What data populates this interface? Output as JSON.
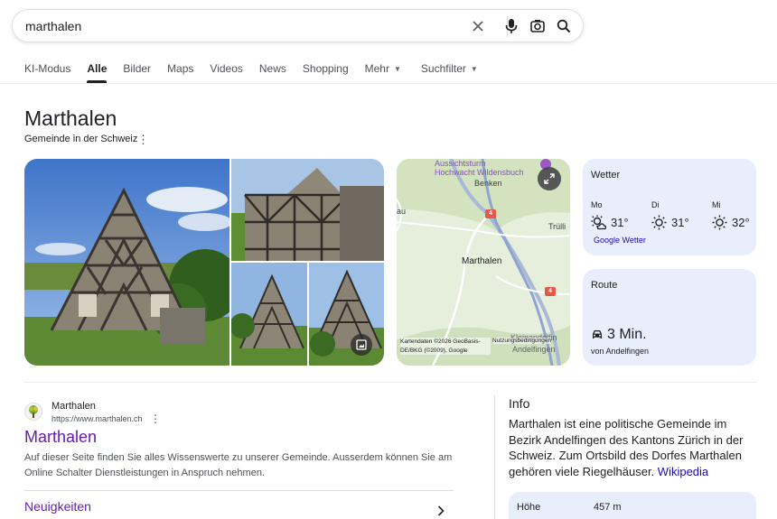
{
  "search": {
    "query": "marthalen"
  },
  "tabs": [
    {
      "label": "KI-Modus"
    },
    {
      "label": "Alle"
    },
    {
      "label": "Bilder"
    },
    {
      "label": "Maps"
    },
    {
      "label": "Videos"
    },
    {
      "label": "News"
    },
    {
      "label": "Shopping"
    },
    {
      "label": "Mehr"
    },
    {
      "label": "Suchfilter"
    }
  ],
  "knowledge": {
    "title": "Marthalen",
    "subtitle": "Gemeinde in der Schweiz"
  },
  "map": {
    "labels": {
      "tower": "Aussichtsturm",
      "hochwacht": "Hochwacht Wildensbuch",
      "benken": "Benken",
      "truellikon": "Trülli",
      "au": "au",
      "marthalen": "Marthalen",
      "kleinandelfingen": "Kleinandelfin",
      "andelfingen": "Andelfingen",
      "road_4a": "4",
      "road_4b": "4"
    },
    "attribution": "Kartendaten ©2026 GeoBasis-DE/BKG (©2009), Google",
    "terms": "Nutzungsbedingungen"
  },
  "weather": {
    "title": "Wetter",
    "days": [
      {
        "day": "Mo",
        "temp": "31°",
        "icon": "sun-cloud-icon"
      },
      {
        "day": "Di",
        "temp": "31°",
        "icon": "sun-icon"
      },
      {
        "day": "Mi",
        "temp": "32°",
        "icon": "sun-icon"
      }
    ],
    "link": "Google Wetter"
  },
  "route": {
    "title": "Route",
    "time": "3 Min.",
    "from": "von Andelfingen",
    "icon": "car-icon"
  },
  "result": {
    "site_name": "Marthalen",
    "url": "https://www.marthalen.ch",
    "title": "Marthalen",
    "snippet": "Auf dieser Seite finden Sie alles Wissenswerte zu unserer Gemeinde. Ausserdem können Sie am Online Schalter Dienstleistungen in Anspruch nehmen.",
    "sublink": "Neuigkeiten"
  },
  "info": {
    "heading": "Info",
    "text": "Marthalen ist eine politische Gemeinde im Bezirk Andelfingen des Kantons Zürich in der Schweiz. Zum Ortsbild des Dorfes Marthalen gehören viele Riegelhäuser.",
    "source": "Wikipedia",
    "facts": [
      {
        "key": "Höhe",
        "value": "457 m"
      }
    ]
  },
  "colors": {
    "link_visited": "#681da8",
    "link": "#1a0dab",
    "card_bg": "#e8eefb",
    "tab_active": "#202124"
  }
}
